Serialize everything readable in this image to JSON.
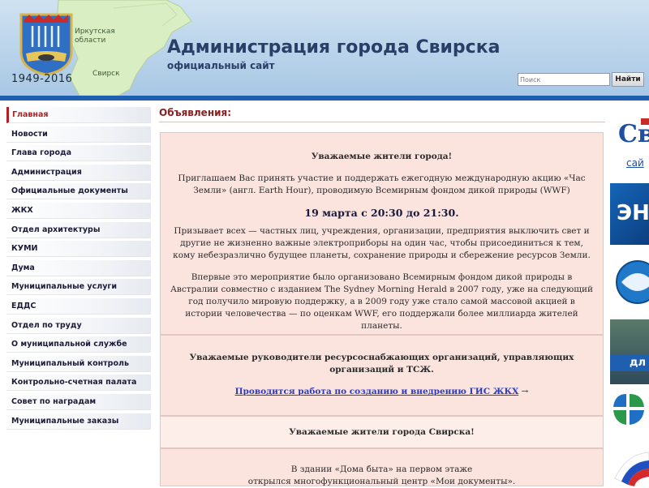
{
  "header": {
    "emblem_years": "1949-2016",
    "region_label": "Иркутская области",
    "town_label": "Свирск",
    "title": "Администрация города Свирска",
    "subtitle": "официальный сайт",
    "search": {
      "placeholder": "Поиск",
      "button_label": "Найти"
    }
  },
  "sidebar": {
    "items": [
      {
        "label": "Главная",
        "active": true
      },
      {
        "label": "Новости"
      },
      {
        "label": "Глава города"
      },
      {
        "label": "Администрация"
      },
      {
        "label": "Официальные документы"
      },
      {
        "label": "ЖКХ"
      },
      {
        "label": "Отдел архитектуры"
      },
      {
        "label": "КУМИ"
      },
      {
        "label": "Дума"
      },
      {
        "label": "Муниципальные услуги"
      },
      {
        "label": "ЕДДС"
      },
      {
        "label": "Отдел по труду"
      },
      {
        "label": "О муниципальной службе"
      },
      {
        "label": "Муниципальный контроль"
      },
      {
        "label": "Контрольно-счетная палата"
      },
      {
        "label": "Совет по наградам"
      },
      {
        "label": "Муниципальные заказы"
      }
    ]
  },
  "main": {
    "heading": "Объявления:",
    "notices": [
      {
        "greeting": "Уважаемые жители города!",
        "p1": "Приглашаем Вас принять участие и поддержать ежегодную международную акцию «Час Земли» (англ. Earth Hour), проводимую Всемирным фондом дикой природы (WWF)",
        "date": "19 марта с 20:30 до 21:30.",
        "p2": "Призывает всех — частных лиц, учреждения, организации, предприятия выключить свет и другие не жизненно важные электроприборы на один час, чтобы присоединиться к тем, кому небезразлично будущее планеты, сохранение природы и сбережение ресурсов Земли.",
        "p3": "Впервые это мероприятие было организовано Всемирным фондом дикой природы в Австралии совместно с изданием The Sydney Morning Herald в 2007 году, уже на следующий год получило мировую поддержку, а в 2009 году уже стало самой массовой акцией в истории человечества — по оценкам WWF, его поддержали более миллиарда жителей планеты."
      },
      {
        "greeting": "Уважаемые руководители ресурсоснабжающих организаций, управляющих организаций и ТСЖ.",
        "link": "Проводится работа по созданию и внедрению ГИС ЖКХ",
        "link_suffix": " →"
      },
      {
        "greeting": "Уважаемые жители города Свирска!"
      },
      {
        "line1": "В здании «Дома быта» на первом этаже",
        "line2": "открылся многофункциональный центр «Мои документы»."
      }
    ]
  },
  "banners": {
    "city_logo_text": "Св",
    "city_logo_sub": "сай",
    "energy_text": "ЭН",
    "slice_text": "дл"
  },
  "colors": {
    "header_blue": "#b9d3ea",
    "header_rule": "#1f5fb0",
    "title_navy": "#2a3f68",
    "heading_red": "#8b2020",
    "notice_pink": "#fbe3de",
    "link_blue": "#2b3bbf"
  }
}
